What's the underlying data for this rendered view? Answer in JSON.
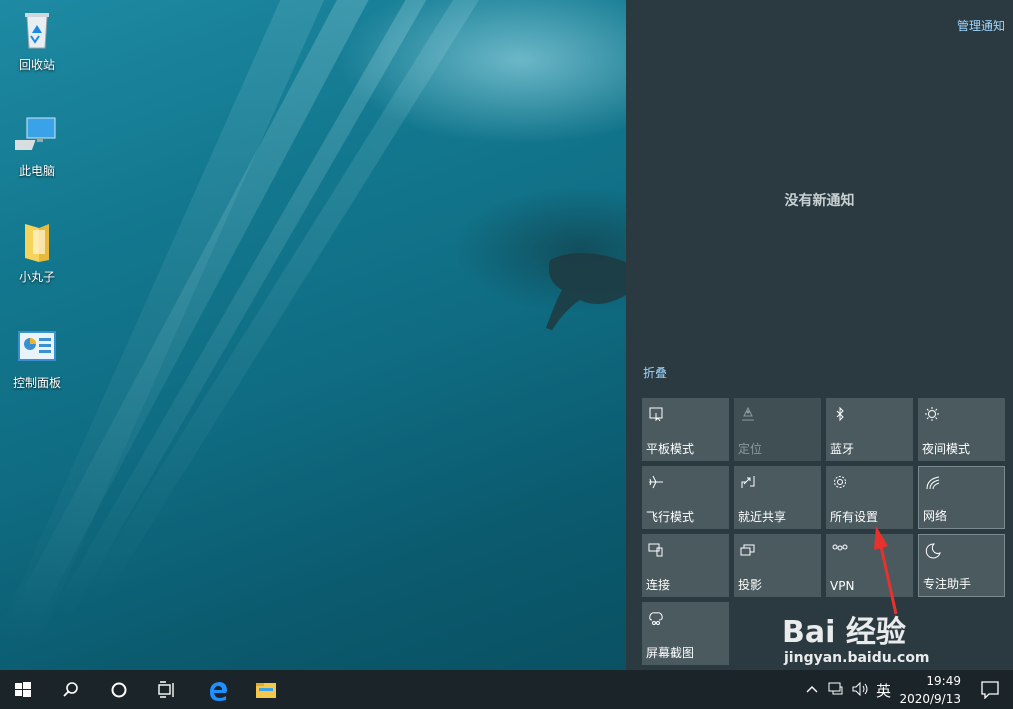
{
  "desktop": {
    "icons": [
      {
        "label": "回收站",
        "icon": "recycle-bin-icon"
      },
      {
        "label": "此电脑",
        "icon": "this-pc-icon"
      },
      {
        "label": "小丸子",
        "icon": "folder-icon"
      },
      {
        "label": "控制面板",
        "icon": "control-panel-icon"
      }
    ]
  },
  "action_center": {
    "manage_label": "管理通知",
    "empty_message": "没有新通知",
    "collapse_label": "折叠",
    "tiles": [
      {
        "label": "平板模式",
        "icon": "tablet-mode-icon",
        "state": "off"
      },
      {
        "label": "定位",
        "icon": "location-icon",
        "state": "disabled"
      },
      {
        "label": "蓝牙",
        "icon": "bluetooth-icon",
        "state": "off"
      },
      {
        "label": "夜间模式",
        "icon": "night-light-icon",
        "state": "off"
      },
      {
        "label": "飞行模式",
        "icon": "airplane-icon",
        "state": "off"
      },
      {
        "label": "就近共享",
        "icon": "nearby-share-icon",
        "state": "off"
      },
      {
        "label": "所有设置",
        "icon": "gear-icon",
        "state": "off"
      },
      {
        "label": "网络",
        "icon": "network-icon",
        "state": "off"
      },
      {
        "label": "连接",
        "icon": "connect-icon",
        "state": "off"
      },
      {
        "label": "投影",
        "icon": "project-icon",
        "state": "off"
      },
      {
        "label": "VPN",
        "icon": "vpn-icon",
        "state": "off"
      },
      {
        "label": "专注助手",
        "icon": "focus-assist-icon",
        "state": "off"
      },
      {
        "label": "屏幕截图",
        "icon": "screen-snip-icon",
        "state": "off"
      }
    ]
  },
  "taskbar": {
    "buttons": [
      "start-icon",
      "search-icon",
      "cortana-icon",
      "task-view-icon",
      "edge-icon",
      "file-explorer-icon"
    ],
    "ime_label": "英",
    "time": "19:49",
    "date": "2020/9/13"
  },
  "watermark": {
    "brand": "Bai 经验",
    "url": "jingyan.baidu.com"
  },
  "colors": {
    "link": "#9fd6ff",
    "panel": "#2b3a40",
    "tile": "#4a5a5f",
    "taskbar": "#1b2429",
    "arrow": "#e8312c"
  }
}
